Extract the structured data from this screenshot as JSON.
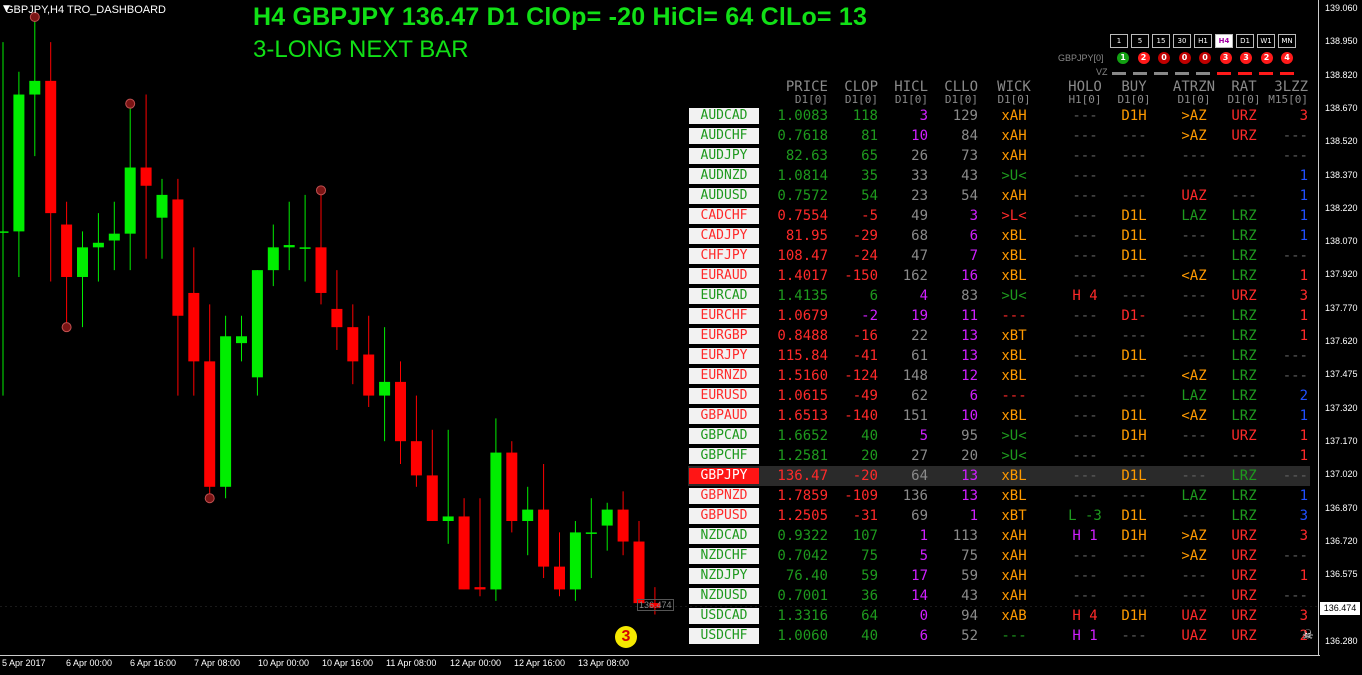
{
  "window": {
    "title": "GBPJPY,H4",
    "indicator": "TRO_DASHBOARD"
  },
  "headline": "H4 GBPJPY 136.47  D1 ClOp= -20 HiCl= 64 ClLo= 13",
  "signal": "3-LONG NEXT BAR",
  "timeframes": [
    "1",
    "5",
    "15",
    "30",
    "H1",
    "H4",
    "D1",
    "W1",
    "MN"
  ],
  "active_timeframe": "H4",
  "trend_symbol": "GBPJPY[0]",
  "trend_dots": [
    {
      "n": "1",
      "c": "#12a012"
    },
    {
      "n": "2",
      "c": "#ff1a1a"
    },
    {
      "n": "0",
      "c": "#c00000"
    },
    {
      "n": "0",
      "c": "#c00000"
    },
    {
      "n": "0",
      "c": "#c00000"
    },
    {
      "n": "3",
      "c": "#ff1a1a"
    },
    {
      "n": "3",
      "c": "#ff1a1a"
    },
    {
      "n": "2",
      "c": "#ff1a1a"
    },
    {
      "n": "4",
      "c": "#ff1a1a"
    }
  ],
  "vz_label": "VZ",
  "vz_colors": [
    "#888",
    "#888",
    "#888",
    "#888",
    "#888",
    "#ff1a1a",
    "#ff1a1a",
    "#ff1a1a",
    "#ff1a1a"
  ],
  "columns": [
    {
      "h": "PRICE",
      "s": "D1[0]"
    },
    {
      "h": "CLOP",
      "s": "D1[0]"
    },
    {
      "h": "HICL",
      "s": "D1[0]"
    },
    {
      "h": "CLLO",
      "s": "D1[0]"
    },
    {
      "h": "WICK",
      "s": "D1[0]"
    },
    {
      "h": "HOLO",
      "s": "H1[0]"
    },
    {
      "h": "BUY",
      "s": "D1[0]"
    },
    {
      "h": "ATRZN",
      "s": "D1[0]"
    },
    {
      "h": "RAT",
      "s": "D1[0]"
    },
    {
      "h": "3LZZ",
      "s": "M15[0]"
    }
  ],
  "colors": {
    "green": "#1e9a1e",
    "red": "#ff2a2a",
    "gray": "#8a8a8a",
    "magenta": "#d020ff",
    "orange": "#ff9a00",
    "blue": "#2050ff",
    "dash": "#606060"
  },
  "rows": [
    {
      "pair": "AUDCAD",
      "pc": "grn",
      "price": "1.0083",
      "prc": "green",
      "clop": "118",
      "cc": "green",
      "hicl": "3",
      "hc": "magenta",
      "cllo": "129",
      "lc": "gray",
      "wick": "xAH",
      "wc": "orange",
      "holo": "---",
      "oc": "dash",
      "buy": "D1H",
      "bc": "orange",
      "atr": ">AZ",
      "ac": "orange",
      "rat": "URZ",
      "rc": "red",
      "lzz": "3",
      "zc": "red"
    },
    {
      "pair": "AUDCHF",
      "pc": "grn",
      "price": "0.7618",
      "prc": "green",
      "clop": "81",
      "cc": "green",
      "hicl": "10",
      "hc": "magenta",
      "cllo": "84",
      "lc": "gray",
      "wick": "xAH",
      "wc": "orange",
      "holo": "---",
      "oc": "dash",
      "buy": "---",
      "bc": "dash",
      "atr": ">AZ",
      "ac": "orange",
      "rat": "URZ",
      "rc": "red",
      "lzz": "---",
      "zc": "dash"
    },
    {
      "pair": "AUDJPY",
      "pc": "grn",
      "price": "82.63",
      "prc": "green",
      "clop": "65",
      "cc": "green",
      "hicl": "26",
      "hc": "gray",
      "cllo": "73",
      "lc": "gray",
      "wick": "xAH",
      "wc": "orange",
      "holo": "---",
      "oc": "dash",
      "buy": "---",
      "bc": "dash",
      "atr": "---",
      "ac": "dash",
      "rat": "---",
      "rc": "dash",
      "lzz": "---",
      "zc": "dash"
    },
    {
      "pair": "AUDNZD",
      "pc": "grn",
      "price": "1.0814",
      "prc": "green",
      "clop": "35",
      "cc": "green",
      "hicl": "33",
      "hc": "gray",
      "cllo": "43",
      "lc": "gray",
      "wick": ">U<",
      "wc": "green",
      "holo": "---",
      "oc": "dash",
      "buy": "---",
      "bc": "dash",
      "atr": "---",
      "ac": "dash",
      "rat": "---",
      "rc": "dash",
      "lzz": "1",
      "zc": "blue"
    },
    {
      "pair": "AUDUSD",
      "pc": "grn",
      "price": "0.7572",
      "prc": "green",
      "clop": "54",
      "cc": "green",
      "hicl": "23",
      "hc": "gray",
      "cllo": "54",
      "lc": "gray",
      "wick": "xAH",
      "wc": "orange",
      "holo": "---",
      "oc": "dash",
      "buy": "---",
      "bc": "dash",
      "atr": "UAZ",
      "ac": "red",
      "rat": "---",
      "rc": "dash",
      "lzz": "1",
      "zc": "blue"
    },
    {
      "pair": "CADCHF",
      "pc": "red",
      "price": "0.7554",
      "prc": "red",
      "clop": "-5",
      "cc": "red",
      "hicl": "49",
      "hc": "gray",
      "cllo": "3",
      "lc": "magenta",
      "wick": ">L<",
      "wc": "red",
      "holo": "---",
      "oc": "dash",
      "buy": "D1L",
      "bc": "orange",
      "atr": "LAZ",
      "ac": "green",
      "rat": "LRZ",
      "rc": "green",
      "lzz": "1",
      "zc": "blue"
    },
    {
      "pair": "CADJPY",
      "pc": "red",
      "price": "81.95",
      "prc": "red",
      "clop": "-29",
      "cc": "red",
      "hicl": "68",
      "hc": "gray",
      "cllo": "6",
      "lc": "magenta",
      "wick": "xBL",
      "wc": "orange",
      "holo": "---",
      "oc": "dash",
      "buy": "D1L",
      "bc": "orange",
      "atr": "---",
      "ac": "dash",
      "rat": "LRZ",
      "rc": "green",
      "lzz": "1",
      "zc": "blue"
    },
    {
      "pair": "CHFJPY",
      "pc": "red",
      "price": "108.47",
      "prc": "red",
      "clop": "-24",
      "cc": "red",
      "hicl": "47",
      "hc": "gray",
      "cllo": "7",
      "lc": "magenta",
      "wick": "xBL",
      "wc": "orange",
      "holo": "---",
      "oc": "dash",
      "buy": "D1L",
      "bc": "orange",
      "atr": "---",
      "ac": "dash",
      "rat": "LRZ",
      "rc": "green",
      "lzz": "---",
      "zc": "dash"
    },
    {
      "pair": "EURAUD",
      "pc": "red",
      "price": "1.4017",
      "prc": "red",
      "clop": "-150",
      "cc": "red",
      "hicl": "162",
      "hc": "gray",
      "cllo": "16",
      "lc": "magenta",
      "wick": "xBL",
      "wc": "orange",
      "holo": "---",
      "oc": "dash",
      "buy": "---",
      "bc": "dash",
      "atr": "<AZ",
      "ac": "orange",
      "rat": "LRZ",
      "rc": "green",
      "lzz": "1",
      "zc": "red"
    },
    {
      "pair": "EURCAD",
      "pc": "grn",
      "price": "1.4135",
      "prc": "green",
      "clop": "6",
      "cc": "green",
      "hicl": "4",
      "hc": "magenta",
      "cllo": "83",
      "lc": "gray",
      "wick": ">U<",
      "wc": "green",
      "holo": "H 4",
      "oc": "red",
      "buy": "---",
      "bc": "dash",
      "atr": "---",
      "ac": "dash",
      "rat": "URZ",
      "rc": "red",
      "lzz": "3",
      "zc": "red"
    },
    {
      "pair": "EURCHF",
      "pc": "red",
      "price": "1.0679",
      "prc": "red",
      "clop": "-2",
      "cc": "magenta",
      "hicl": "19",
      "hc": "magenta",
      "cllo": "11",
      "lc": "magenta",
      "wick": "---",
      "wc": "red",
      "holo": "---",
      "oc": "dash",
      "buy": "D1-",
      "bc": "red",
      "atr": "---",
      "ac": "dash",
      "rat": "LRZ",
      "rc": "green",
      "lzz": "1",
      "zc": "red"
    },
    {
      "pair": "EURGBP",
      "pc": "red",
      "price": "0.8488",
      "prc": "red",
      "clop": "-16",
      "cc": "red",
      "hicl": "22",
      "hc": "gray",
      "cllo": "13",
      "lc": "magenta",
      "wick": "xBT",
      "wc": "orange",
      "holo": "---",
      "oc": "dash",
      "buy": "---",
      "bc": "dash",
      "atr": "---",
      "ac": "dash",
      "rat": "LRZ",
      "rc": "green",
      "lzz": "1",
      "zc": "red"
    },
    {
      "pair": "EURJPY",
      "pc": "red",
      "price": "115.84",
      "prc": "red",
      "clop": "-41",
      "cc": "red",
      "hicl": "61",
      "hc": "gray",
      "cllo": "13",
      "lc": "magenta",
      "wick": "xBL",
      "wc": "orange",
      "holo": "---",
      "oc": "dash",
      "buy": "D1L",
      "bc": "orange",
      "atr": "---",
      "ac": "dash",
      "rat": "LRZ",
      "rc": "green",
      "lzz": "---",
      "zc": "dash"
    },
    {
      "pair": "EURNZD",
      "pc": "red",
      "price": "1.5160",
      "prc": "red",
      "clop": "-124",
      "cc": "red",
      "hicl": "148",
      "hc": "gray",
      "cllo": "12",
      "lc": "magenta",
      "wick": "xBL",
      "wc": "orange",
      "holo": "---",
      "oc": "dash",
      "buy": "---",
      "bc": "dash",
      "atr": "<AZ",
      "ac": "orange",
      "rat": "LRZ",
      "rc": "green",
      "lzz": "---",
      "zc": "dash"
    },
    {
      "pair": "EURUSD",
      "pc": "red",
      "price": "1.0615",
      "prc": "red",
      "clop": "-49",
      "cc": "red",
      "hicl": "62",
      "hc": "gray",
      "cllo": "6",
      "lc": "magenta",
      "wick": "---",
      "wc": "red",
      "holo": "---",
      "oc": "dash",
      "buy": "---",
      "bc": "dash",
      "atr": "LAZ",
      "ac": "green",
      "rat": "LRZ",
      "rc": "green",
      "lzz": "2",
      "zc": "blue"
    },
    {
      "pair": "GBPAUD",
      "pc": "red",
      "price": "1.6513",
      "prc": "red",
      "clop": "-140",
      "cc": "red",
      "hicl": "151",
      "hc": "gray",
      "cllo": "10",
      "lc": "magenta",
      "wick": "xBL",
      "wc": "orange",
      "holo": "---",
      "oc": "dash",
      "buy": "D1L",
      "bc": "orange",
      "atr": "<AZ",
      "ac": "orange",
      "rat": "LRZ",
      "rc": "green",
      "lzz": "1",
      "zc": "blue"
    },
    {
      "pair": "GBPCAD",
      "pc": "grn",
      "price": "1.6652",
      "prc": "green",
      "clop": "40",
      "cc": "green",
      "hicl": "5",
      "hc": "magenta",
      "cllo": "95",
      "lc": "gray",
      "wick": ">U<",
      "wc": "green",
      "holo": "---",
      "oc": "dash",
      "buy": "D1H",
      "bc": "orange",
      "atr": "---",
      "ac": "dash",
      "rat": "URZ",
      "rc": "red",
      "lzz": "1",
      "zc": "red"
    },
    {
      "pair": "GBPCHF",
      "pc": "grn",
      "price": "1.2581",
      "prc": "green",
      "clop": "20",
      "cc": "green",
      "hicl": "27",
      "hc": "gray",
      "cllo": "20",
      "lc": "gray",
      "wick": ">U<",
      "wc": "green",
      "holo": "---",
      "oc": "dash",
      "buy": "---",
      "bc": "dash",
      "atr": "---",
      "ac": "dash",
      "rat": "---",
      "rc": "dash",
      "lzz": "1",
      "zc": "red"
    },
    {
      "pair": "GBPJPY",
      "pc": "sel",
      "price": "136.47",
      "prc": "red",
      "clop": "-20",
      "cc": "red",
      "hicl": "64",
      "hc": "gray",
      "cllo": "13",
      "lc": "magenta",
      "wick": "xBL",
      "wc": "orange",
      "holo": "---",
      "oc": "dash",
      "buy": "D1L",
      "bc": "orange",
      "atr": "---",
      "ac": "dash",
      "rat": "LRZ",
      "rc": "green",
      "lzz": "---",
      "zc": "dash",
      "hl": true
    },
    {
      "pair": "GBPNZD",
      "pc": "red",
      "price": "1.7859",
      "prc": "red",
      "clop": "-109",
      "cc": "red",
      "hicl": "136",
      "hc": "gray",
      "cllo": "13",
      "lc": "magenta",
      "wick": "xBL",
      "wc": "orange",
      "holo": "---",
      "oc": "dash",
      "buy": "---",
      "bc": "dash",
      "atr": "LAZ",
      "ac": "green",
      "rat": "LRZ",
      "rc": "green",
      "lzz": "1",
      "zc": "blue"
    },
    {
      "pair": "GBPUSD",
      "pc": "red",
      "price": "1.2505",
      "prc": "red",
      "clop": "-31",
      "cc": "red",
      "hicl": "69",
      "hc": "gray",
      "cllo": "1",
      "lc": "magenta",
      "wick": "xBT",
      "wc": "orange",
      "holo": "L -3",
      "oc": "green",
      "buy": "D1L",
      "bc": "orange",
      "atr": "---",
      "ac": "dash",
      "rat": "LRZ",
      "rc": "green",
      "lzz": "3",
      "zc": "blue"
    },
    {
      "pair": "NZDCAD",
      "pc": "grn",
      "price": "0.9322",
      "prc": "green",
      "clop": "107",
      "cc": "green",
      "hicl": "1",
      "hc": "magenta",
      "cllo": "113",
      "lc": "gray",
      "wick": "xAH",
      "wc": "orange",
      "holo": "H 1",
      "oc": "magenta",
      "buy": "D1H",
      "bc": "orange",
      "atr": ">AZ",
      "ac": "orange",
      "rat": "URZ",
      "rc": "red",
      "lzz": "3",
      "zc": "red"
    },
    {
      "pair": "NZDCHF",
      "pc": "grn",
      "price": "0.7042",
      "prc": "green",
      "clop": "75",
      "cc": "green",
      "hicl": "5",
      "hc": "magenta",
      "cllo": "75",
      "lc": "gray",
      "wick": "xAH",
      "wc": "orange",
      "holo": "---",
      "oc": "dash",
      "buy": "---",
      "bc": "dash",
      "atr": ">AZ",
      "ac": "orange",
      "rat": "URZ",
      "rc": "red",
      "lzz": "---",
      "zc": "dash"
    },
    {
      "pair": "NZDJPY",
      "pc": "grn",
      "price": "76.40",
      "prc": "green",
      "clop": "59",
      "cc": "green",
      "hicl": "17",
      "hc": "magenta",
      "cllo": "59",
      "lc": "gray",
      "wick": "xAH",
      "wc": "orange",
      "holo": "---",
      "oc": "dash",
      "buy": "---",
      "bc": "dash",
      "atr": "---",
      "ac": "dash",
      "rat": "URZ",
      "rc": "red",
      "lzz": "1",
      "zc": "red"
    },
    {
      "pair": "NZDUSD",
      "pc": "grn",
      "price": "0.7001",
      "prc": "green",
      "clop": "36",
      "cc": "green",
      "hicl": "14",
      "hc": "magenta",
      "cllo": "43",
      "lc": "gray",
      "wick": "xAH",
      "wc": "orange",
      "holo": "---",
      "oc": "dash",
      "buy": "---",
      "bc": "dash",
      "atr": "---",
      "ac": "dash",
      "rat": "URZ",
      "rc": "red",
      "lzz": "---",
      "zc": "dash"
    },
    {
      "pair": "USDCAD",
      "pc": "grn",
      "price": "1.3316",
      "prc": "green",
      "clop": "64",
      "cc": "green",
      "hicl": "0",
      "hc": "magenta",
      "cllo": "94",
      "lc": "gray",
      "wick": "xAB",
      "wc": "orange",
      "holo": "H 4",
      "oc": "red",
      "buy": "D1H",
      "bc": "orange",
      "atr": "UAZ",
      "ac": "red",
      "rat": "URZ",
      "rc": "red",
      "lzz": "3",
      "zc": "red"
    },
    {
      "pair": "USDCHF",
      "pc": "grn",
      "price": "1.0060",
      "prc": "green",
      "clop": "40",
      "cc": "green",
      "hicl": "6",
      "hc": "magenta",
      "cllo": "52",
      "lc": "gray",
      "wick": "---",
      "wc": "green",
      "holo": "H 1",
      "oc": "magenta",
      "buy": "---",
      "bc": "dash",
      "atr": "UAZ",
      "ac": "red",
      "rat": "URZ",
      "rc": "red",
      "lzz": "2",
      "zc": "red"
    }
  ],
  "y_axis": [
    "139.060",
    "138.950",
    "138.820",
    "138.670",
    "138.520",
    "138.370",
    "138.220",
    "138.070",
    "137.920",
    "137.770",
    "137.620",
    "137.475",
    "137.320",
    "137.170",
    "137.020",
    "136.870",
    "136.720",
    "136.575",
    "136.430",
    "136.280"
  ],
  "current_price_label": "136.474",
  "x_axis": [
    "5 Apr 2017",
    "6 Apr 00:00",
    "6 Apr 16:00",
    "7 Apr 08:00",
    "10 Apr 00:00",
    "10 Apr 16:00",
    "11 Apr 08:00",
    "12 Apr 00:00",
    "12 Apr 16:00",
    "13 Apr 08:00"
  ],
  "bar_count": "3",
  "mini_tag": "136.474",
  "candles": [
    {
      "o": 138.12,
      "h": 138.95,
      "l": 137.4,
      "c": 138.12
    },
    {
      "o": 138.12,
      "h": 138.82,
      "l": 137.92,
      "c": 138.72
    },
    {
      "o": 138.72,
      "h": 139.06,
      "l": 138.45,
      "c": 138.78
    },
    {
      "o": 138.78,
      "h": 138.95,
      "l": 137.9,
      "c": 138.2
    },
    {
      "o": 138.15,
      "h": 138.25,
      "l": 137.7,
      "c": 137.92
    },
    {
      "o": 137.92,
      "h": 138.12,
      "l": 137.7,
      "c": 138.05
    },
    {
      "o": 138.05,
      "h": 138.2,
      "l": 137.9,
      "c": 138.07
    },
    {
      "o": 138.08,
      "h": 138.25,
      "l": 137.95,
      "c": 138.11
    },
    {
      "o": 138.11,
      "h": 138.68,
      "l": 137.95,
      "c": 138.4
    },
    {
      "o": 138.4,
      "h": 138.72,
      "l": 138.0,
      "c": 138.32
    },
    {
      "o": 138.18,
      "h": 138.35,
      "l": 138.0,
      "c": 138.28
    },
    {
      "o": 138.26,
      "h": 138.35,
      "l": 137.4,
      "c": 137.75
    },
    {
      "o": 137.85,
      "h": 138.05,
      "l": 137.4,
      "c": 137.55
    },
    {
      "o": 137.55,
      "h": 137.8,
      "l": 136.95,
      "c": 137.0
    },
    {
      "o": 137.0,
      "h": 137.75,
      "l": 136.95,
      "c": 137.66
    },
    {
      "o": 137.63,
      "h": 137.75,
      "l": 137.55,
      "c": 137.66
    },
    {
      "o": 137.48,
      "h": 137.95,
      "l": 137.4,
      "c": 137.95
    },
    {
      "o": 137.95,
      "h": 138.15,
      "l": 137.88,
      "c": 138.05
    },
    {
      "o": 138.05,
      "h": 138.25,
      "l": 137.95,
      "c": 138.06
    },
    {
      "o": 138.05,
      "h": 138.28,
      "l": 137.9,
      "c": 138.05
    },
    {
      "o": 138.05,
      "h": 138.3,
      "l": 137.8,
      "c": 137.85
    },
    {
      "o": 137.78,
      "h": 137.95,
      "l": 137.6,
      "c": 137.7
    },
    {
      "o": 137.7,
      "h": 137.8,
      "l": 137.45,
      "c": 137.55
    },
    {
      "o": 137.58,
      "h": 137.75,
      "l": 137.35,
      "c": 137.4
    },
    {
      "o": 137.4,
      "h": 137.7,
      "l": 137.2,
      "c": 137.46
    },
    {
      "o": 137.46,
      "h": 137.55,
      "l": 137.1,
      "c": 137.2
    },
    {
      "o": 137.2,
      "h": 137.4,
      "l": 137.0,
      "c": 137.05
    },
    {
      "o": 137.05,
      "h": 137.25,
      "l": 136.9,
      "c": 136.85
    },
    {
      "o": 136.85,
      "h": 137.25,
      "l": 136.75,
      "c": 136.87
    },
    {
      "o": 136.87,
      "h": 136.95,
      "l": 136.55,
      "c": 136.55
    },
    {
      "o": 136.56,
      "h": 136.95,
      "l": 136.52,
      "c": 136.55
    },
    {
      "o": 136.55,
      "h": 137.3,
      "l": 136.5,
      "c": 137.15
    },
    {
      "o": 137.15,
      "h": 137.2,
      "l": 136.8,
      "c": 136.85
    },
    {
      "o": 136.85,
      "h": 137.0,
      "l": 136.7,
      "c": 136.9
    },
    {
      "o": 136.9,
      "h": 137.1,
      "l": 136.6,
      "c": 136.65
    },
    {
      "o": 136.65,
      "h": 136.8,
      "l": 136.52,
      "c": 136.55
    },
    {
      "o": 136.55,
      "h": 136.85,
      "l": 136.5,
      "c": 136.8
    },
    {
      "o": 136.8,
      "h": 136.95,
      "l": 136.6,
      "c": 136.8
    },
    {
      "o": 136.83,
      "h": 136.93,
      "l": 136.72,
      "c": 136.9
    },
    {
      "o": 136.9,
      "h": 136.98,
      "l": 136.7,
      "c": 136.76
    },
    {
      "o": 136.76,
      "h": 136.85,
      "l": 136.49,
      "c": 136.49
    },
    {
      "o": 136.49,
      "h": 136.56,
      "l": 136.44,
      "c": 136.47
    }
  ],
  "markers": [
    {
      "i": 2,
      "p": 139.06
    },
    {
      "i": 4,
      "p": 137.7
    },
    {
      "i": 8,
      "p": 138.68
    },
    {
      "i": 13,
      "p": 136.95
    },
    {
      "i": 20,
      "p": 138.3
    }
  ]
}
